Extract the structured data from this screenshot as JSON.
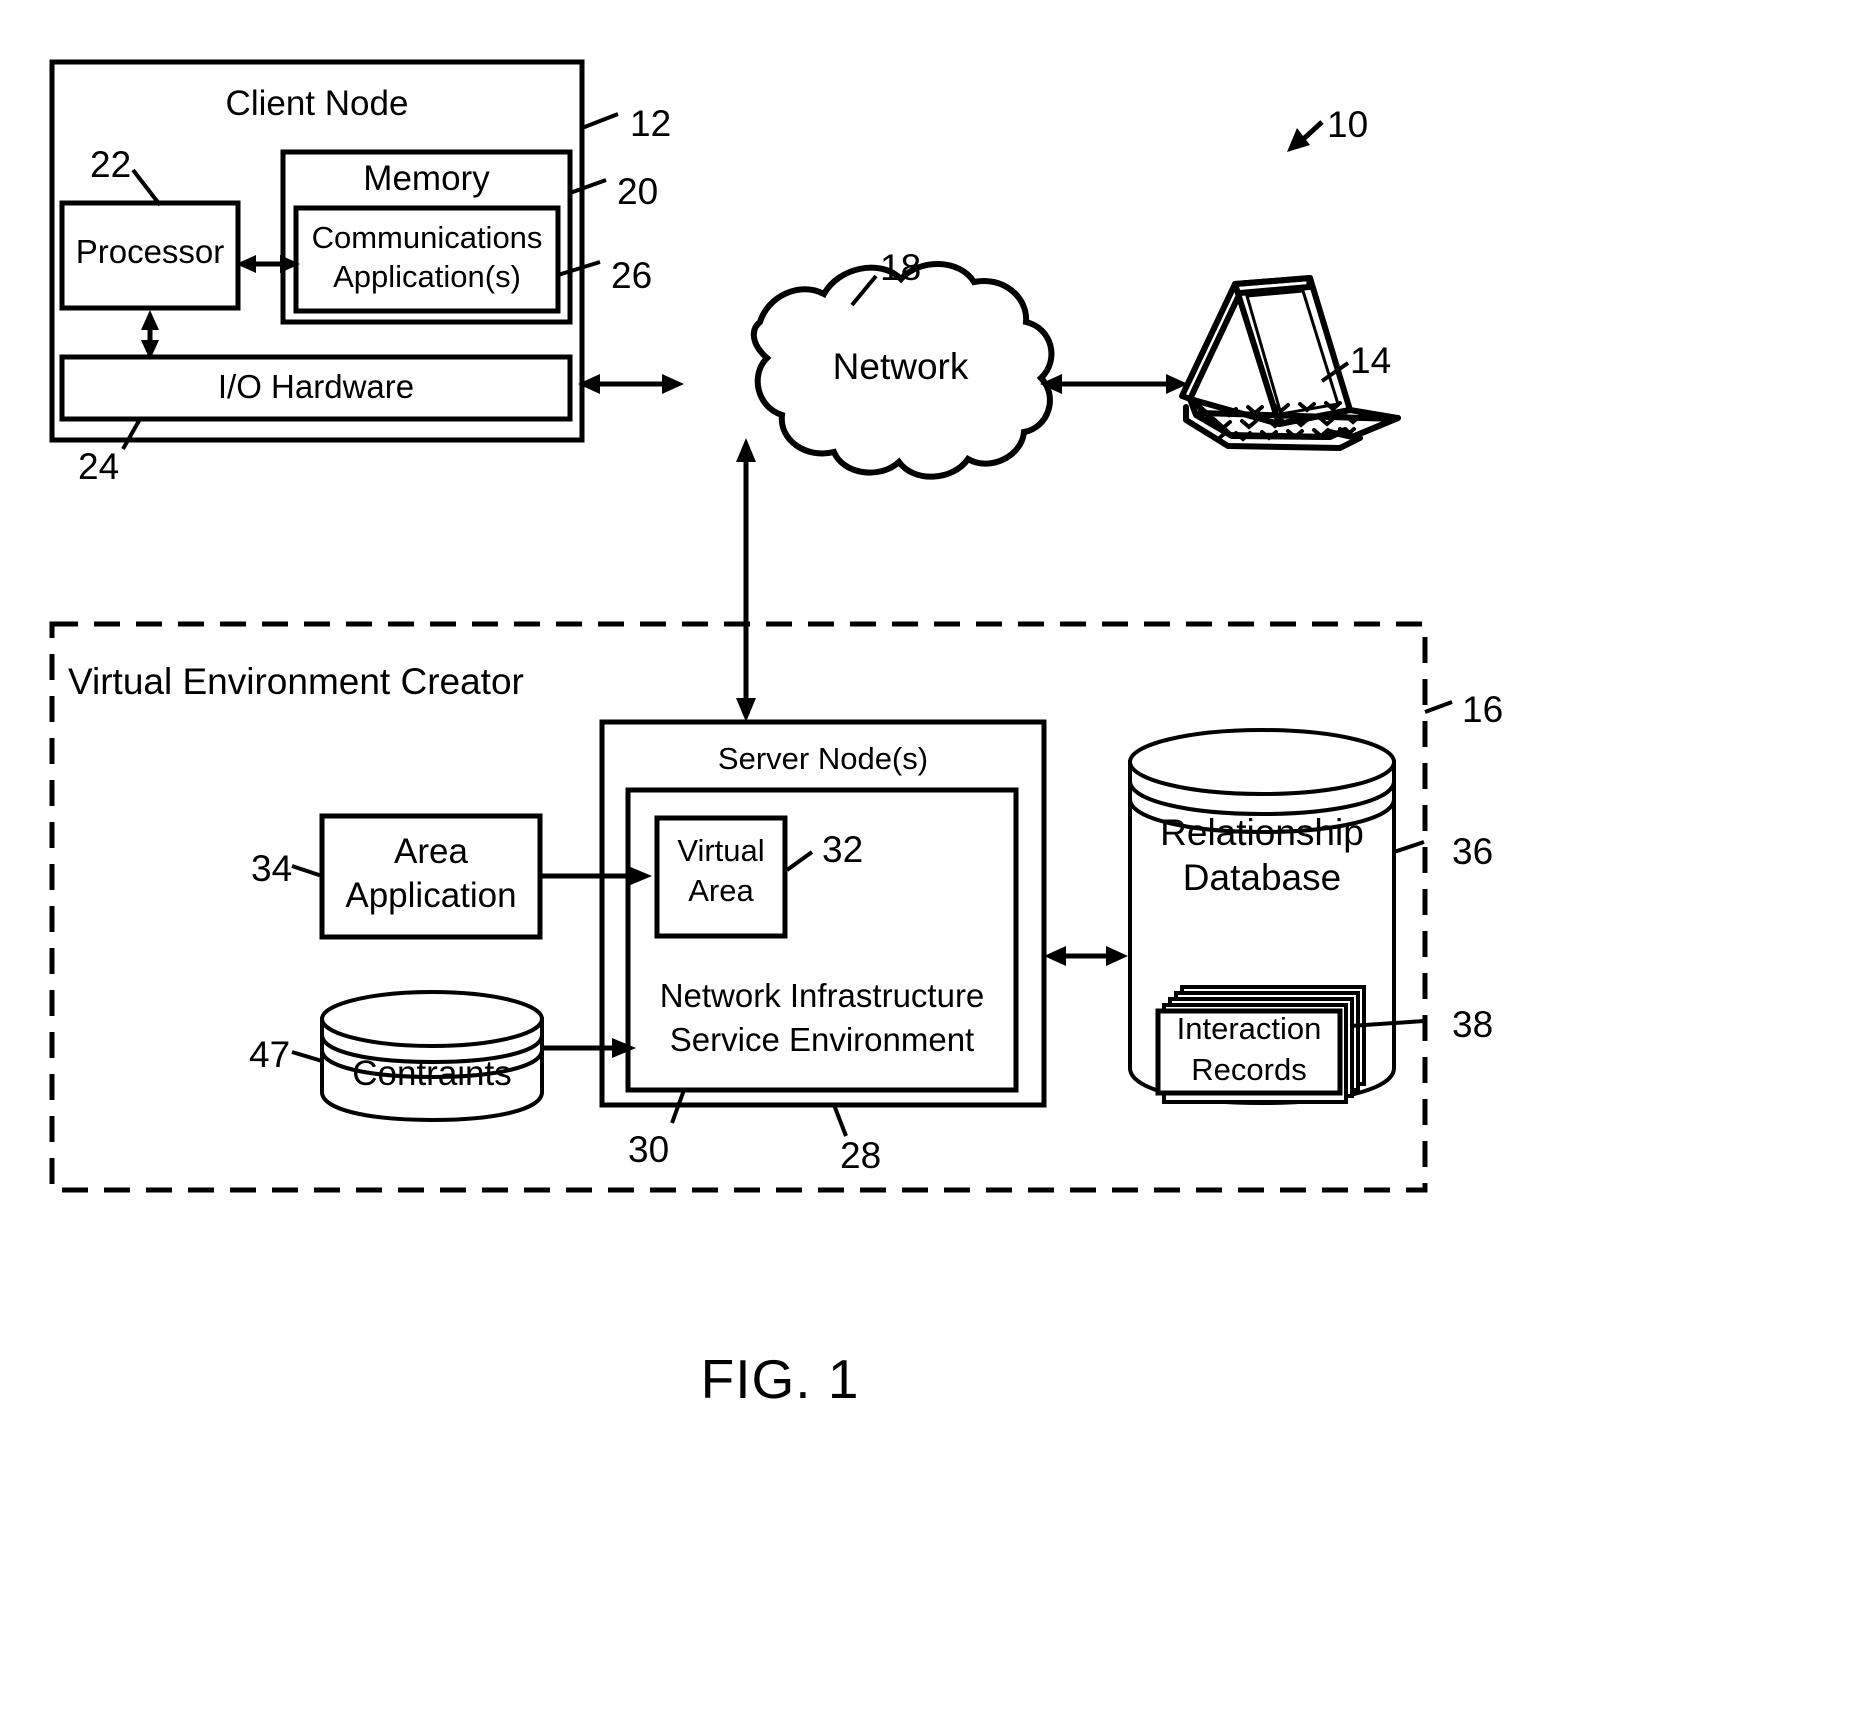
{
  "figure": {
    "caption": "FIG. 1",
    "system_ref": "10"
  },
  "client_node": {
    "title": "Client Node",
    "ref": "12",
    "processor": {
      "label": "Processor",
      "ref": "22"
    },
    "memory": {
      "label": "Memory",
      "ref": "20"
    },
    "communications_application": {
      "label": "Communications\nApplication(s)",
      "line1": "Communications",
      "line2": "Application(s)",
      "ref": "26"
    },
    "io_hardware": {
      "label": "I/O Hardware",
      "ref": "24"
    }
  },
  "network": {
    "label": "Network",
    "ref": "18"
  },
  "remote_client": {
    "icon": "laptop-icon",
    "ref": "14"
  },
  "virtual_environment_creator": {
    "title": "Virtual Environment Creator",
    "ref": "16",
    "area_application": {
      "line1": "Area",
      "line2": "Application",
      "ref": "34"
    },
    "contraints": {
      "label": "Contraints",
      "ref": "47"
    },
    "server_node": {
      "label": "Server Node(s)",
      "ref": "28"
    },
    "virtual_area": {
      "line1": "Virtual",
      "line2": "Area",
      "ref": "32"
    },
    "network_infrastructure": {
      "line1": "Network Infrastructure",
      "line2": "Service Environment",
      "ref": "30"
    },
    "relationship_database": {
      "line1": "Relationship",
      "line2": "Database",
      "ref": "36"
    },
    "interaction_records": {
      "line1": "Interaction",
      "line2": "Records",
      "ref": "38"
    }
  },
  "colors": {
    "ink": "#000000",
    "paper": "#ffffff"
  }
}
